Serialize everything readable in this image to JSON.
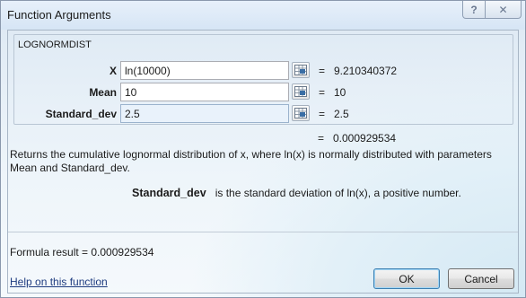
{
  "window": {
    "title": "Function Arguments",
    "help_glyph": "?",
    "close_glyph": "✕"
  },
  "function_name": "LOGNORMDIST",
  "arguments": [
    {
      "label": "X",
      "value": "ln(10000)",
      "result": "9.210340372"
    },
    {
      "label": "Mean",
      "value": "10",
      "result": "10"
    },
    {
      "label": "Standard_dev",
      "value": "2.5",
      "result": "2.5"
    }
  ],
  "equals": "=",
  "function_result": "0.000929534",
  "description": "Returns the cumulative lognormal distribution of x, where ln(x) is normally distributed with parameters Mean and Standard_dev.",
  "argument_help": {
    "name": "Standard_dev",
    "text": "is the standard deviation of ln(x), a positive number."
  },
  "formula_result": {
    "label": "Formula result =",
    "value": "0.000929534"
  },
  "help_link": "Help on this function",
  "buttons": {
    "ok": "OK",
    "cancel": "Cancel"
  },
  "icons": {
    "reference": "collapse-dialog-icon"
  }
}
